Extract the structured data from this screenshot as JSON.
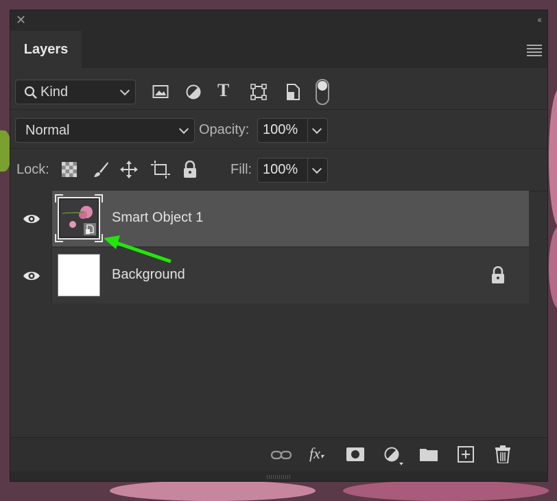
{
  "panel": {
    "tab_label": "Layers",
    "close_icon": "close-icon",
    "collapse_icon": "double-chevron-left-icon",
    "menu_icon": "panel-menu-icon"
  },
  "filter": {
    "kind_label": "Kind",
    "filter_icons": [
      "image-filter-icon",
      "adjustment-filter-icon",
      "type-filter-icon",
      "shape-filter-icon",
      "smart-object-filter-icon",
      "filter-toggle-switch"
    ]
  },
  "blend": {
    "mode": "Normal",
    "opacity_label": "Opacity:",
    "opacity_value": "100%"
  },
  "lock": {
    "label": "Lock:",
    "fill_label": "Fill:",
    "fill_value": "100%",
    "lock_icons": [
      "lock-transparent-icon",
      "lock-image-icon",
      "lock-position-icon",
      "lock-artboard-icon",
      "lock-all-icon"
    ]
  },
  "layers": [
    {
      "name": "Smart Object 1",
      "selected": true,
      "type": "smart-object"
    },
    {
      "name": "Background",
      "selected": false,
      "locked": true
    }
  ],
  "footer_icons": [
    "link-layers-icon",
    "fx-icon",
    "add-mask-icon",
    "adjustment-layer-icon",
    "new-group-icon",
    "new-layer-icon",
    "delete-layer-icon"
  ],
  "colors": {
    "panel": "#323232",
    "selected_row": "#535353",
    "annotation_arrow": "#22e60a"
  }
}
